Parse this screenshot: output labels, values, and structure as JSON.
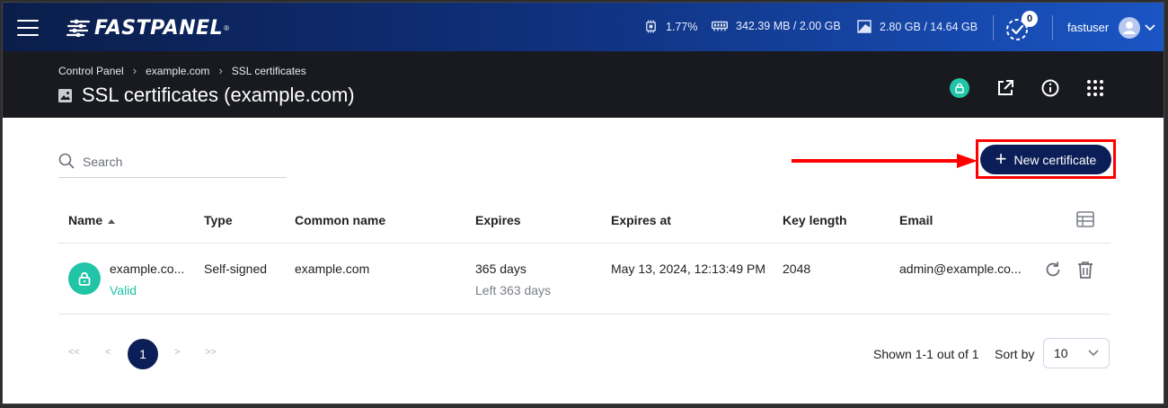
{
  "header": {
    "logo_text": "FASTPANEL",
    "logo_reg": "®",
    "cpu": "1.77%",
    "ram": "342.39 MB / 2.00 GB",
    "disk": "2.80 GB / 14.64 GB",
    "tasks_count": "0",
    "username": "fastuser",
    "gradient_colors": [
      "#0b1e4a",
      "#1a55c4"
    ]
  },
  "breadcrumb": [
    "Control Panel",
    "example.com",
    "SSL certificates"
  ],
  "page_title": "SSL certificates (example.com)",
  "toolbar": {
    "search_placeholder": "Search",
    "new_button_label": "New certificate",
    "accent_color": "#0c1e57",
    "highlight_color": "#ff0000"
  },
  "table": {
    "columns": [
      "Name",
      "Type",
      "Common name",
      "Expires",
      "Expires at",
      "Key length",
      "Email"
    ],
    "rows": [
      {
        "name": "example.co...",
        "status": "Valid",
        "type": "Self-signed",
        "common_name": "example.com",
        "expires": "365 days",
        "expires_left": "Left 363 days",
        "expires_at": "May 13, 2024, 12:13:49 PM",
        "key_length": "2048",
        "email": "admin@example.co..."
      }
    ],
    "status_color": "#21c4a6"
  },
  "pagination": {
    "first": "<<",
    "prev": "<",
    "current": "1",
    "next": ">",
    "last": ">>",
    "shown_text": "Shown 1-1 out of 1",
    "sort_label": "Sort by",
    "page_size": "10"
  }
}
